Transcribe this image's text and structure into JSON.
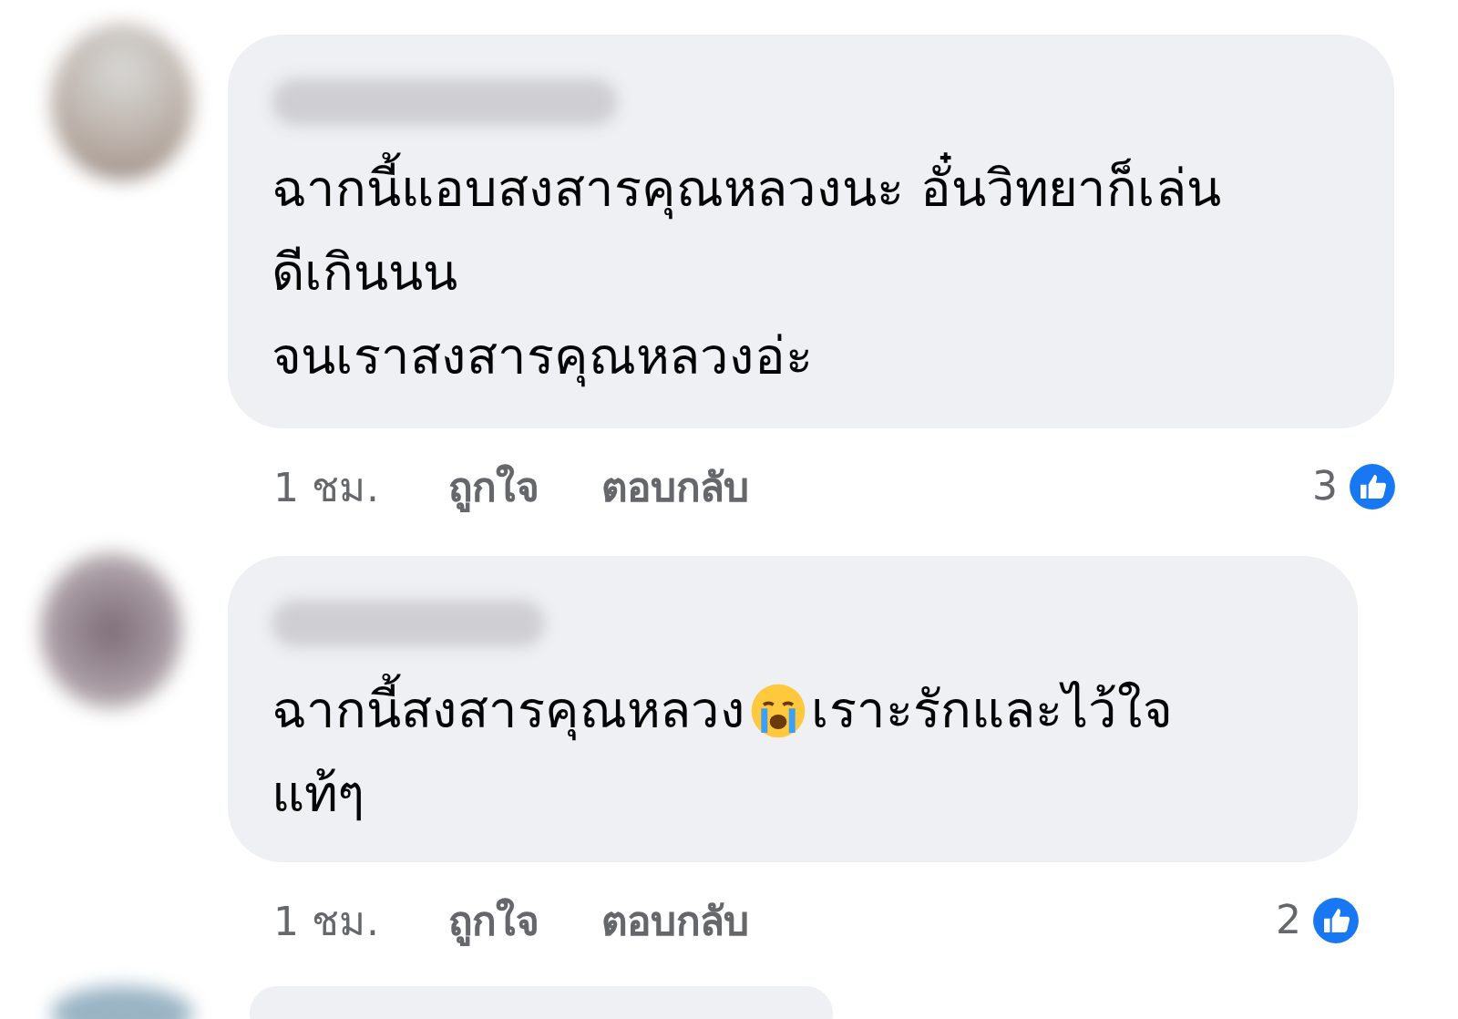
{
  "comments": [
    {
      "lines": [
        [
          {
            "kind": "text",
            "text": "ฉากนี้แอบสงสารคุณหลวงนะ อั๋นวิทยาก็เล่น"
          }
        ],
        [
          {
            "kind": "text",
            "text": "ดีเกินนน"
          }
        ],
        [
          {
            "kind": "text",
            "text": "จนเราสงสารคุณหลวงอ่ะ"
          }
        ]
      ],
      "time": "1 ชม.",
      "like": "ถูกใจ",
      "reply": "ตอบกลับ",
      "reactions": "3"
    },
    {
      "lines": [
        [
          {
            "kind": "text",
            "text": "ฉากนี้สงสารคุณหลวง"
          },
          {
            "kind": "emoji"
          },
          {
            "kind": "text",
            "text": " เราะรักและไว้ใจ"
          }
        ],
        [
          {
            "kind": "text",
            "text": "แท้ๆ"
          }
        ]
      ],
      "time": "1 ชม.",
      "like": "ถูกใจ",
      "reply": "ตอบกลับ",
      "reactions": "2"
    }
  ]
}
